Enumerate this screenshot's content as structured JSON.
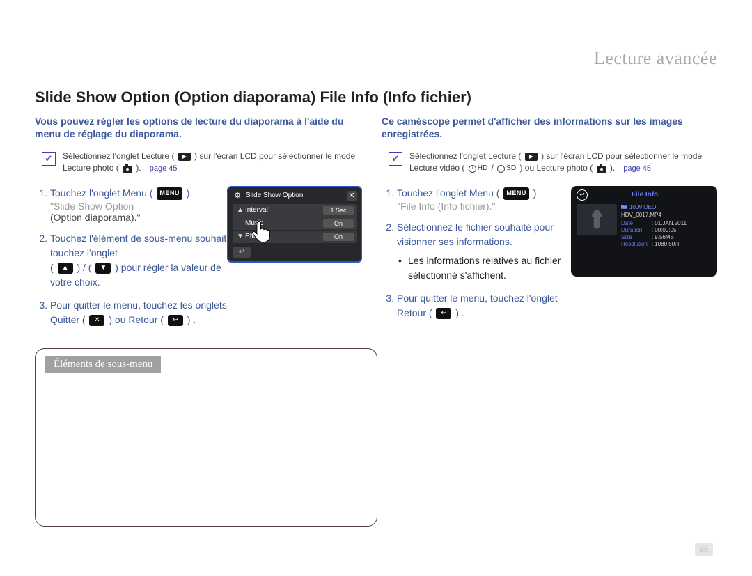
{
  "header": {
    "section_title": "Lecture avancée"
  },
  "main_title": "Slide Show Option (Option diaporama)   File Info (Info fichier)",
  "left": {
    "lead": "Vous pouvez régler les options de lecture du diaporama à l'aide du menu de réglage du diaporama.",
    "select_note": {
      "text_before": "Sélectionnez l'onglet Lecture (",
      "text_mid": ") sur l'écran LCD pour sélectionner le mode Lecture photo (",
      "text_after": ").",
      "page_ref": "page 45"
    },
    "steps": {
      "s1_a": "Touchez l'onglet Menu (",
      "s1_b": ").",
      "s1_c": "\"Slide Show Option",
      "s1_d": "(Option diaporama).\"",
      "s2_a": "Touchez l'élément de sous-menu souhaité et touchez l'onglet",
      "s2_b": "(",
      "s2_c": ") / (",
      "s2_d": ") pour régler la valeur de votre choix.",
      "s3_a": "Pour quitter le menu, touchez les onglets Quitter (",
      "s3_b": ") ou Retour (",
      "s3_c": ") ."
    },
    "panel": {
      "title": "Slide Show Option",
      "rows": [
        {
          "label": "Interval",
          "value": "1 Sec"
        },
        {
          "label": "Music",
          "value": "On"
        },
        {
          "label": "Effect",
          "value": "On"
        }
      ]
    },
    "submenu_title": "Éléments de sous-menu"
  },
  "right": {
    "lead": "Ce caméscope permet d'afficher des informations sur les images enregistrées.",
    "select_note": {
      "text_before": "Sélectionnez l'onglet Lecture (",
      "text_mid": ") sur l'écran LCD pour sélectionner le mode Lecture vidéo (",
      "hd": "HD",
      "sd": "SD",
      "text_mid2": ") ou Lecture photo (",
      "text_after": ").",
      "page_ref": "page 45"
    },
    "steps": {
      "s1_a": "Touchez l'onglet Menu (",
      "s1_b": ")",
      "s1_c": "\"File Info (Info fichier).\"",
      "s2": "Sélectionnez le fichier souhaité pour visionner ses informations.",
      "s2_bullet": "Les informations relatives au fichier sélectionné s'affichent.",
      "s3_a": "Pour quitter le menu, touchez l'onglet Retour (",
      "s3_b": ") ."
    },
    "panel": {
      "title": "File Info",
      "folder": "100VIDEO",
      "filename": "HDV_0017.MP4",
      "rows": [
        {
          "k": "Date",
          "v": "01.JAN.2011"
        },
        {
          "k": "Duration",
          "v": "00:00:05"
        },
        {
          "k": "Size",
          "v": "9.56MB"
        },
        {
          "k": "Resolution",
          "v": "1080 50i F"
        }
      ]
    }
  },
  "page_number": "96",
  "labels": {
    "menu_badge": "MENU"
  }
}
